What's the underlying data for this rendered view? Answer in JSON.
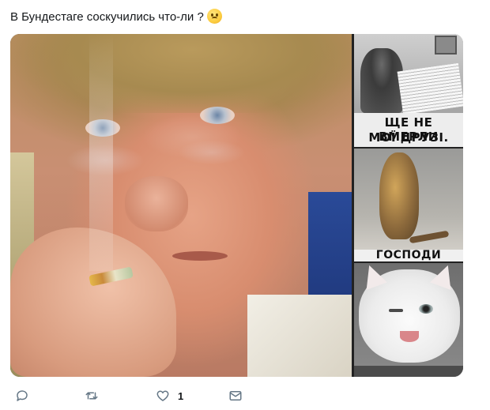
{
  "tweet": {
    "text": "В Бундестаге соскучились что-ли ?",
    "emoji": "confused-face-emoji"
  },
  "media": {
    "memes": [
      {
        "caption_lines": [
          "ЩЕ НЕ ВМЕРЛИ",
          "МОЇ ДРУЗІ."
        ]
      },
      {
        "caption_lines": [
          "ГОСПОДИ"
        ]
      },
      {
        "caption_lines": []
      }
    ]
  },
  "actions": {
    "reply_icon": "reply-icon",
    "retweet_icon": "retweet-icon",
    "like_icon": "heart-icon",
    "like_count": "1",
    "dm_icon": "envelope-icon"
  },
  "colors": {
    "icon_gray": "#657786",
    "text": "#14171a",
    "link": "#1da1f2"
  }
}
